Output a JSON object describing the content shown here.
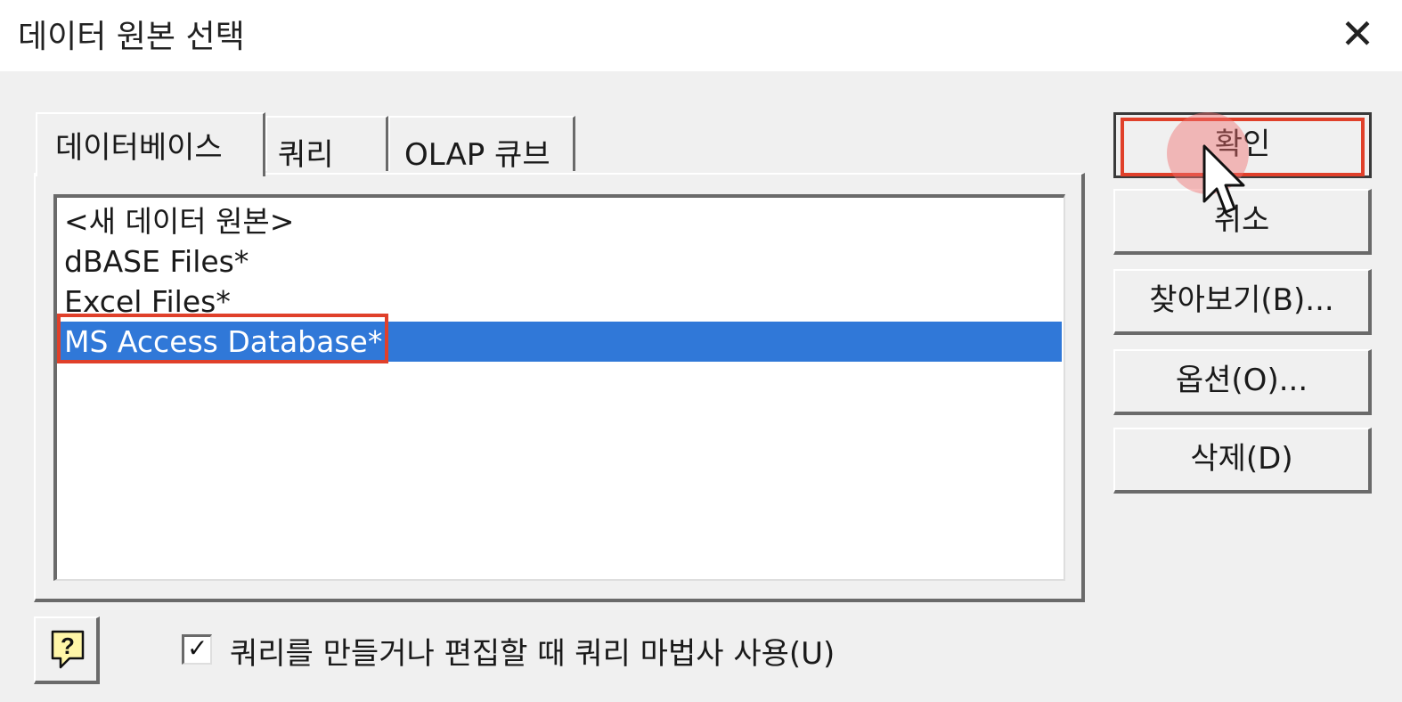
{
  "dialog": {
    "title": "데이터 원본 선택",
    "close_glyph": "✕"
  },
  "tabs": [
    {
      "label": "데이터베이스",
      "active": true
    },
    {
      "label": "쿼리",
      "active": false
    },
    {
      "label": "OLAP 큐브",
      "active": false
    }
  ],
  "data_sources": {
    "items": [
      "<새 데이터 원본>",
      "dBASE Files*",
      "Excel Files*",
      "MS Access Database*"
    ],
    "selected": "MS Access Database*"
  },
  "buttons": {
    "ok": "확인",
    "cancel": "취소",
    "browse": "찾아보기(B)...",
    "options": "옵션(O)...",
    "delete": "삭제(D)"
  },
  "query_wizard": {
    "label": "쿼리를 만들거나 편집할 때 쿼리 마법사 사용(U)",
    "checked": true,
    "check_glyph": "✓"
  },
  "help": {
    "glyph": "?"
  },
  "colors": {
    "selection": "#3078d8",
    "annotation": "#e0402a"
  }
}
